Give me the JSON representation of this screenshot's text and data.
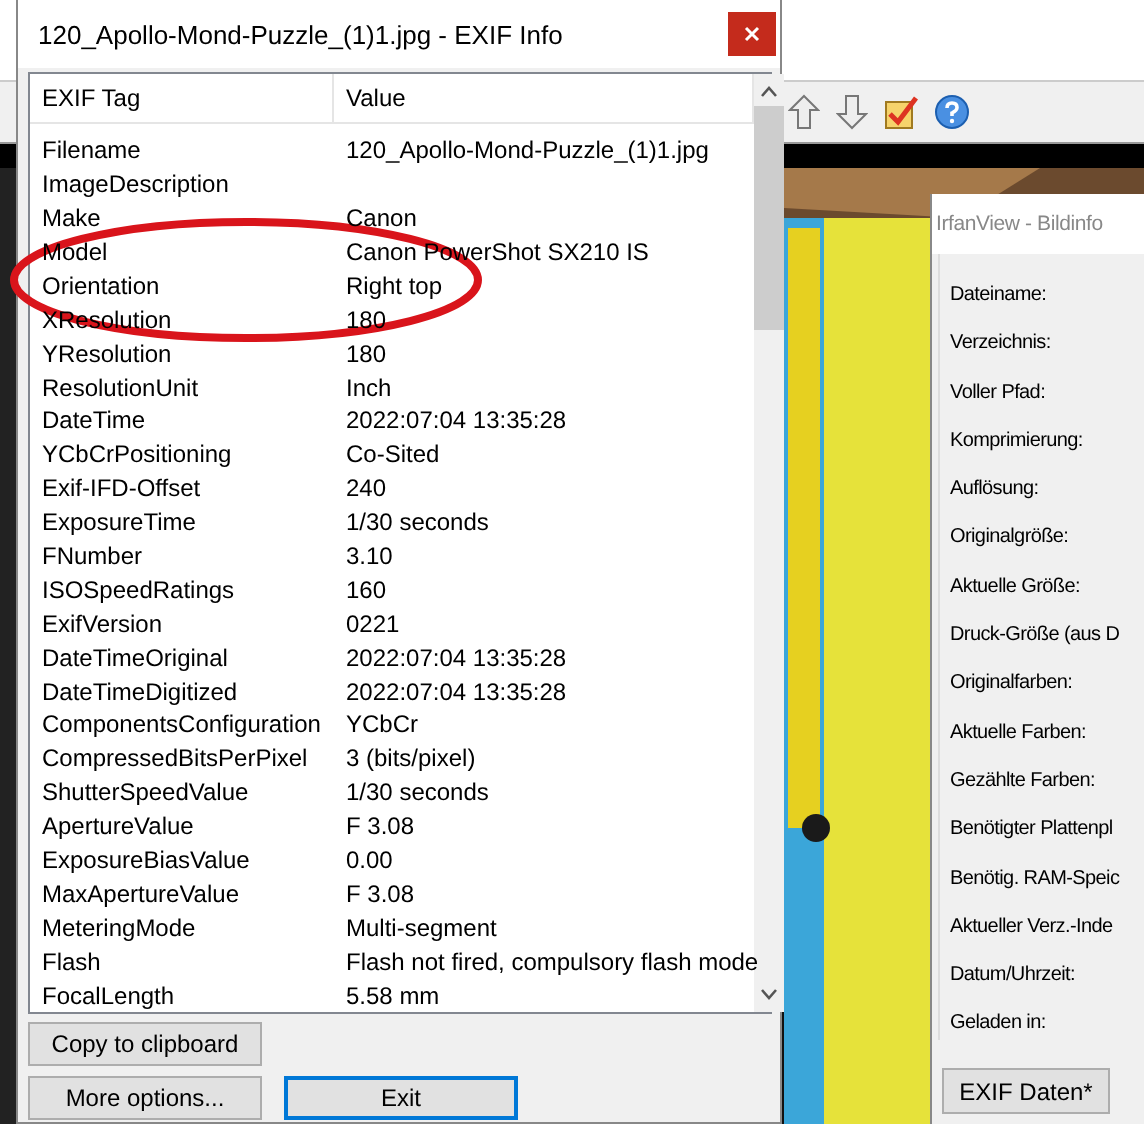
{
  "exif_window": {
    "title": "120_Apollo-Mond-Puzzle_(1)1.jpg - EXIF Info",
    "columns": [
      "EXIF Tag",
      "Value"
    ],
    "rows": [
      {
        "tag": "Filename",
        "value": "120_Apollo-Mond-Puzzle_(1)1.jpg"
      },
      {
        "tag": "ImageDescription",
        "value": ""
      },
      {
        "tag": "Make",
        "value": "Canon"
      },
      {
        "tag": "Model",
        "value": "Canon PowerShot SX210 IS"
      },
      {
        "tag": "Orientation",
        "value": "Right top"
      },
      {
        "tag": "XResolution",
        "value": "180"
      },
      {
        "tag": "YResolution",
        "value": "180"
      },
      {
        "tag": "ResolutionUnit",
        "value": "Inch"
      },
      {
        "tag": "DateTime",
        "value": "2022:07:04 13:35:28"
      },
      {
        "tag": "YCbCrPositioning",
        "value": "Co-Sited"
      },
      {
        "tag": "Exif-IFD-Offset",
        "value": "240"
      },
      {
        "tag": "ExposureTime",
        "value": "1/30 seconds"
      },
      {
        "tag": "FNumber",
        "value": "3.10"
      },
      {
        "tag": "ISOSpeedRatings",
        "value": "160"
      },
      {
        "tag": "ExifVersion",
        "value": "0221"
      },
      {
        "tag": "DateTimeOriginal",
        "value": "2022:07:04 13:35:28"
      },
      {
        "tag": "DateTimeDigitized",
        "value": "2022:07:04 13:35:28"
      },
      {
        "tag": "ComponentsConfiguration",
        "value": "YCbCr"
      },
      {
        "tag": "CompressedBitsPerPixel",
        "value": "3 (bits/pixel)"
      },
      {
        "tag": "ShutterSpeedValue",
        "value": "1/30 seconds"
      },
      {
        "tag": "ApertureValue",
        "value": "F 3.08"
      },
      {
        "tag": "ExposureBiasValue",
        "value": "0.00"
      },
      {
        "tag": "MaxApertureValue",
        "value": "F 3.08"
      },
      {
        "tag": "MeteringMode",
        "value": "Multi-segment"
      },
      {
        "tag": "Flash",
        "value": "Flash not fired, compulsory flash mode"
      },
      {
        "tag": "FocalLength",
        "value": "5.58 mm"
      }
    ],
    "buttons": [
      {
        "label": "Copy to clipboard",
        "selected": false
      },
      {
        "label": "More options...",
        "selected": false
      },
      {
        "label": "Exit",
        "selected": true
      }
    ]
  },
  "info_window": {
    "title": "IrfanView - Bildinfo",
    "labels": [
      "Dateiname:",
      "Verzeichnis:",
      "Voller Pfad:",
      "Komprimierung:",
      "Auflösung:",
      "Originalgröße:",
      "Aktuelle Größe:",
      "Druck-Größe (aus D",
      "Originalfarben:",
      "Aktuelle Farben:",
      "Gezählte Farben:",
      "Benötigter Plattenpl",
      "Benötig. RAM-Speic",
      "Aktueller Verz.-Inde",
      "Datum/Uhrzeit:",
      "Geladen in:"
    ],
    "button": "EXIF Daten*"
  }
}
